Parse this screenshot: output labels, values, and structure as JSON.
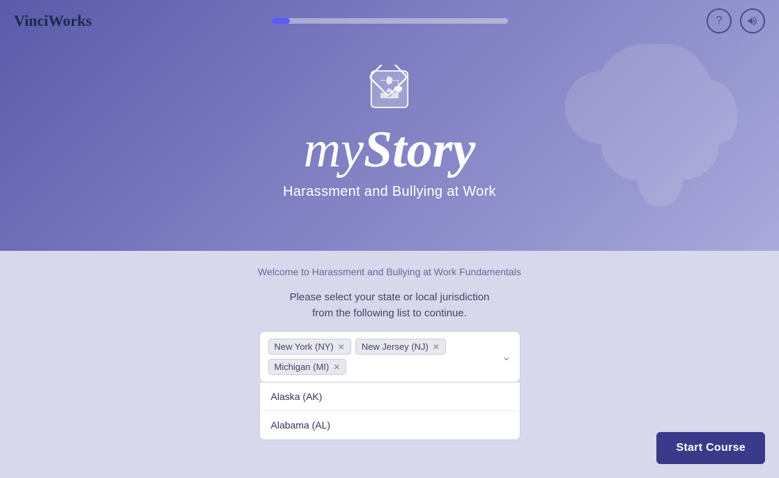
{
  "header": {
    "logo": "VinciWorks",
    "progress_percent": 8,
    "help_icon": "?",
    "audio_icon": "🔊"
  },
  "hero": {
    "puzzle_icon_label": "puzzle-piece",
    "title_my": "my",
    "title_story": "Story",
    "subtitle": "Harassment and Bullying at Work"
  },
  "content": {
    "welcome_text": "Welcome to Harassment and Bullying at Work Fundamentals",
    "select_prompt_line1": "Please select your state or local jurisdiction",
    "select_prompt_line2": "from the following list to continue.",
    "selected_tags": [
      {
        "label": "New York (NY)",
        "id": "ny"
      },
      {
        "label": "New Jersey (NJ)",
        "id": "nj"
      },
      {
        "label": "Michigan (MI)",
        "id": "mi"
      }
    ],
    "dropdown_items": [
      {
        "label": "Alaska (AK)",
        "id": "ak"
      },
      {
        "label": "Alabama (AL)",
        "id": "al"
      }
    ]
  },
  "footer": {
    "start_button_label": "Start Course"
  }
}
